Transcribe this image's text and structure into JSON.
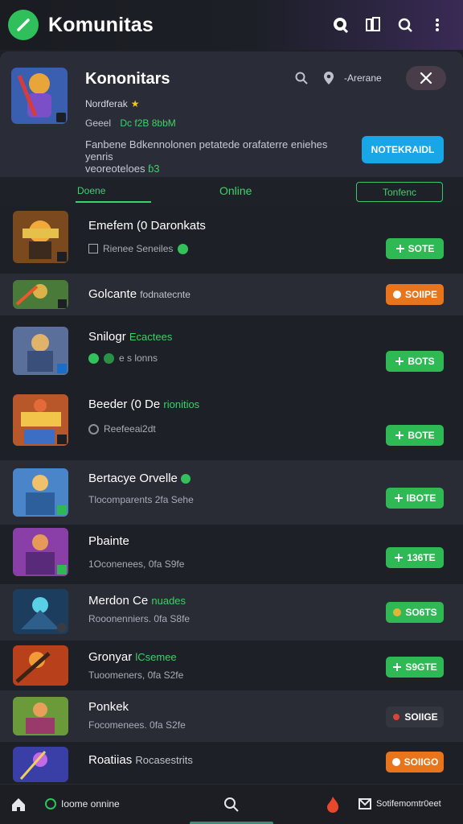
{
  "header": {
    "title": "Komunitas",
    "accent": "#2fbf5b"
  },
  "community": {
    "name": "Kononitars",
    "meta": "Nordferak",
    "sub_label": "Geeel",
    "sub_value": "Dc f2B 8bbM",
    "description_main": "Fanbene Bdkennolonen petatede orafaterre eniehes yenris",
    "description_line2": "veoreoteloes",
    "description_count": "ɓ3",
    "action_text": "-Arerane",
    "notify_label": "NOTEKRAIDL"
  },
  "tabs": [
    {
      "label": "Doene",
      "active": true
    },
    {
      "label": "Online",
      "active": false
    },
    {
      "label": "Tonfenc",
      "active": false
    }
  ],
  "rows": [
    {
      "title": "Emefem (0 Daronkats",
      "title_green": "",
      "sub": "Rienee Seneiles",
      "sub_icon": "square",
      "button": "SOTE",
      "button_style": "green",
      "alt": false
    },
    {
      "title": "Golcante",
      "title_green": "",
      "sub": "",
      "title_suffix": "fodnatecnte",
      "sub_icon": "none",
      "button": "SOIIPE",
      "button_style": "orange",
      "alt": true
    },
    {
      "title": "Snilogr",
      "title_green": "Ecactees",
      "sub": "e  s lonns",
      "sub_icon": "green",
      "button": "BOTS",
      "button_style": "green",
      "alt": false
    },
    {
      "title": "Beeder (0 De",
      "title_green": "rionitios",
      "sub": "Reefeeai2dt",
      "sub_icon": "grey",
      "button": "BOTE",
      "button_style": "green",
      "alt": false
    },
    {
      "title": "Bertacye Orvelle",
      "title_green": "",
      "sub": "Tlocomparents  2fa  Sehe",
      "sub_icon": "none",
      "button": "IBOTE",
      "button_style": "green",
      "alt": true
    },
    {
      "title": "Pbainte",
      "title_green": "",
      "sub": "1Oconenees,  0fa  S9fe",
      "sub_icon": "none",
      "button": "136TE",
      "button_style": "green",
      "alt": false
    },
    {
      "title": "Merdon Ce",
      "title_green": "nuades",
      "sub": "Rooonenniers.  0fa  S8fe",
      "sub_icon": "none",
      "button": "SO6TS",
      "button_style": "green",
      "alt": true
    },
    {
      "title": "Gronyar",
      "title_green": "lCsemee",
      "sub": "Tuoomeners,  0fa  S2fe",
      "sub_icon": "none",
      "button": "S9GTE",
      "button_style": "green",
      "alt": false
    },
    {
      "title": "Ponkek",
      "title_green": "",
      "sub": "Focomenees.  0fa  S2fe",
      "sub_icon": "none",
      "button": "SOIIGE",
      "button_style": "dark",
      "alt": true
    },
    {
      "title": "Roatiias",
      "title_green": "",
      "title_suffix": "Rocasestrits",
      "sub": "",
      "sub_icon": "none",
      "button": "SOIIGO",
      "button_style": "orange",
      "alt": false
    }
  ],
  "bottom_nav": {
    "online_label": "Ioome onnine",
    "mail_label": "Sotifemomtr0eet"
  }
}
